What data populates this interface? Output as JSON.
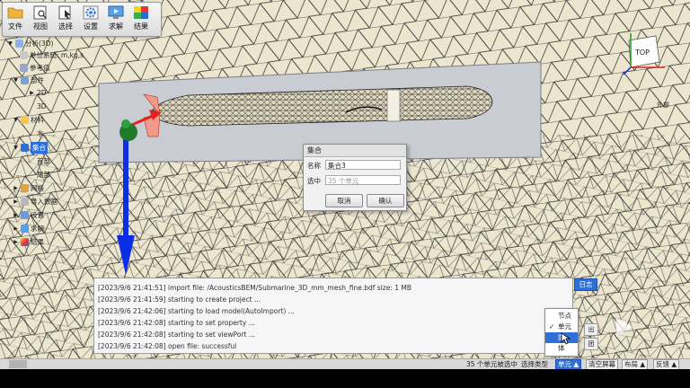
{
  "toolbar": {
    "buttons": [
      {
        "label": "文件",
        "icon": "folder-icon"
      },
      {
        "label": "视图",
        "icon": "view-icon"
      },
      {
        "label": "选择",
        "icon": "select-icon"
      },
      {
        "label": "设置",
        "icon": "gear-icon"
      },
      {
        "label": "求解",
        "icon": "solve-icon"
      },
      {
        "label": "结果",
        "icon": "result-icon"
      }
    ]
  },
  "tree": {
    "root": "分析(3D)",
    "unit_system": "单位系统: m,kg,s",
    "reference": "参考值",
    "parts": "部件",
    "parts_2d": "2D",
    "parts_3d": "3D",
    "material": "材料",
    "material_water": "水",
    "set": "集合",
    "set_head": "首部",
    "set_tail": "尾部",
    "mesh": "网格",
    "import_data": "导入数据",
    "settings": "设置",
    "solve": "求解",
    "result": "结果"
  },
  "viewcube": {
    "face": "TOP"
  },
  "right_partial_label": "外部",
  "dialog": {
    "title": "集合",
    "name_label": "名称",
    "name_value": "集合3",
    "selection_label": "选中",
    "selection_placeholder": "35 个单元",
    "cancel": "取消",
    "confirm": "确认"
  },
  "log": {
    "button": "日志",
    "lines": [
      "[2023/9/6 21:41:51] import file: /AcousticsBEM/Submarine_3D_mm_mesh_fine.bdf size: 1 MB",
      "[2023/9/6 21:41:59] starting to create project ...",
      "[2023/9/6 21:42:06] starting to load model(AutoImport) ...",
      "[2023/9/6 21:42:08] starting to set property ...",
      "[2023/9/6 21:42:08] starting to set viewPort ...",
      "[2023/9/6 21:42:08] open file: successful"
    ],
    "side_partial_1": "出",
    "side_partial_2": "团"
  },
  "popup": {
    "items": [
      "节点",
      "单元",
      "面",
      "体"
    ],
    "checked_index": 1,
    "highlighted_index": 2
  },
  "status": {
    "selected": "35 个单元被选中",
    "select_type_label": "选择类型",
    "select_type_value": "单元 ▲",
    "clear": "清空屏幕",
    "layout": "布局 ▲",
    "feedback": "反馈 ▲"
  },
  "colors": {
    "background": "#ece6cf",
    "mesh_lines": "#2a2a2a",
    "highlight_blue": "#2f6fd6",
    "axis_blue": "#0a2ee6",
    "axis_red": "#e22222",
    "axis_green": "#1f7a2a"
  }
}
